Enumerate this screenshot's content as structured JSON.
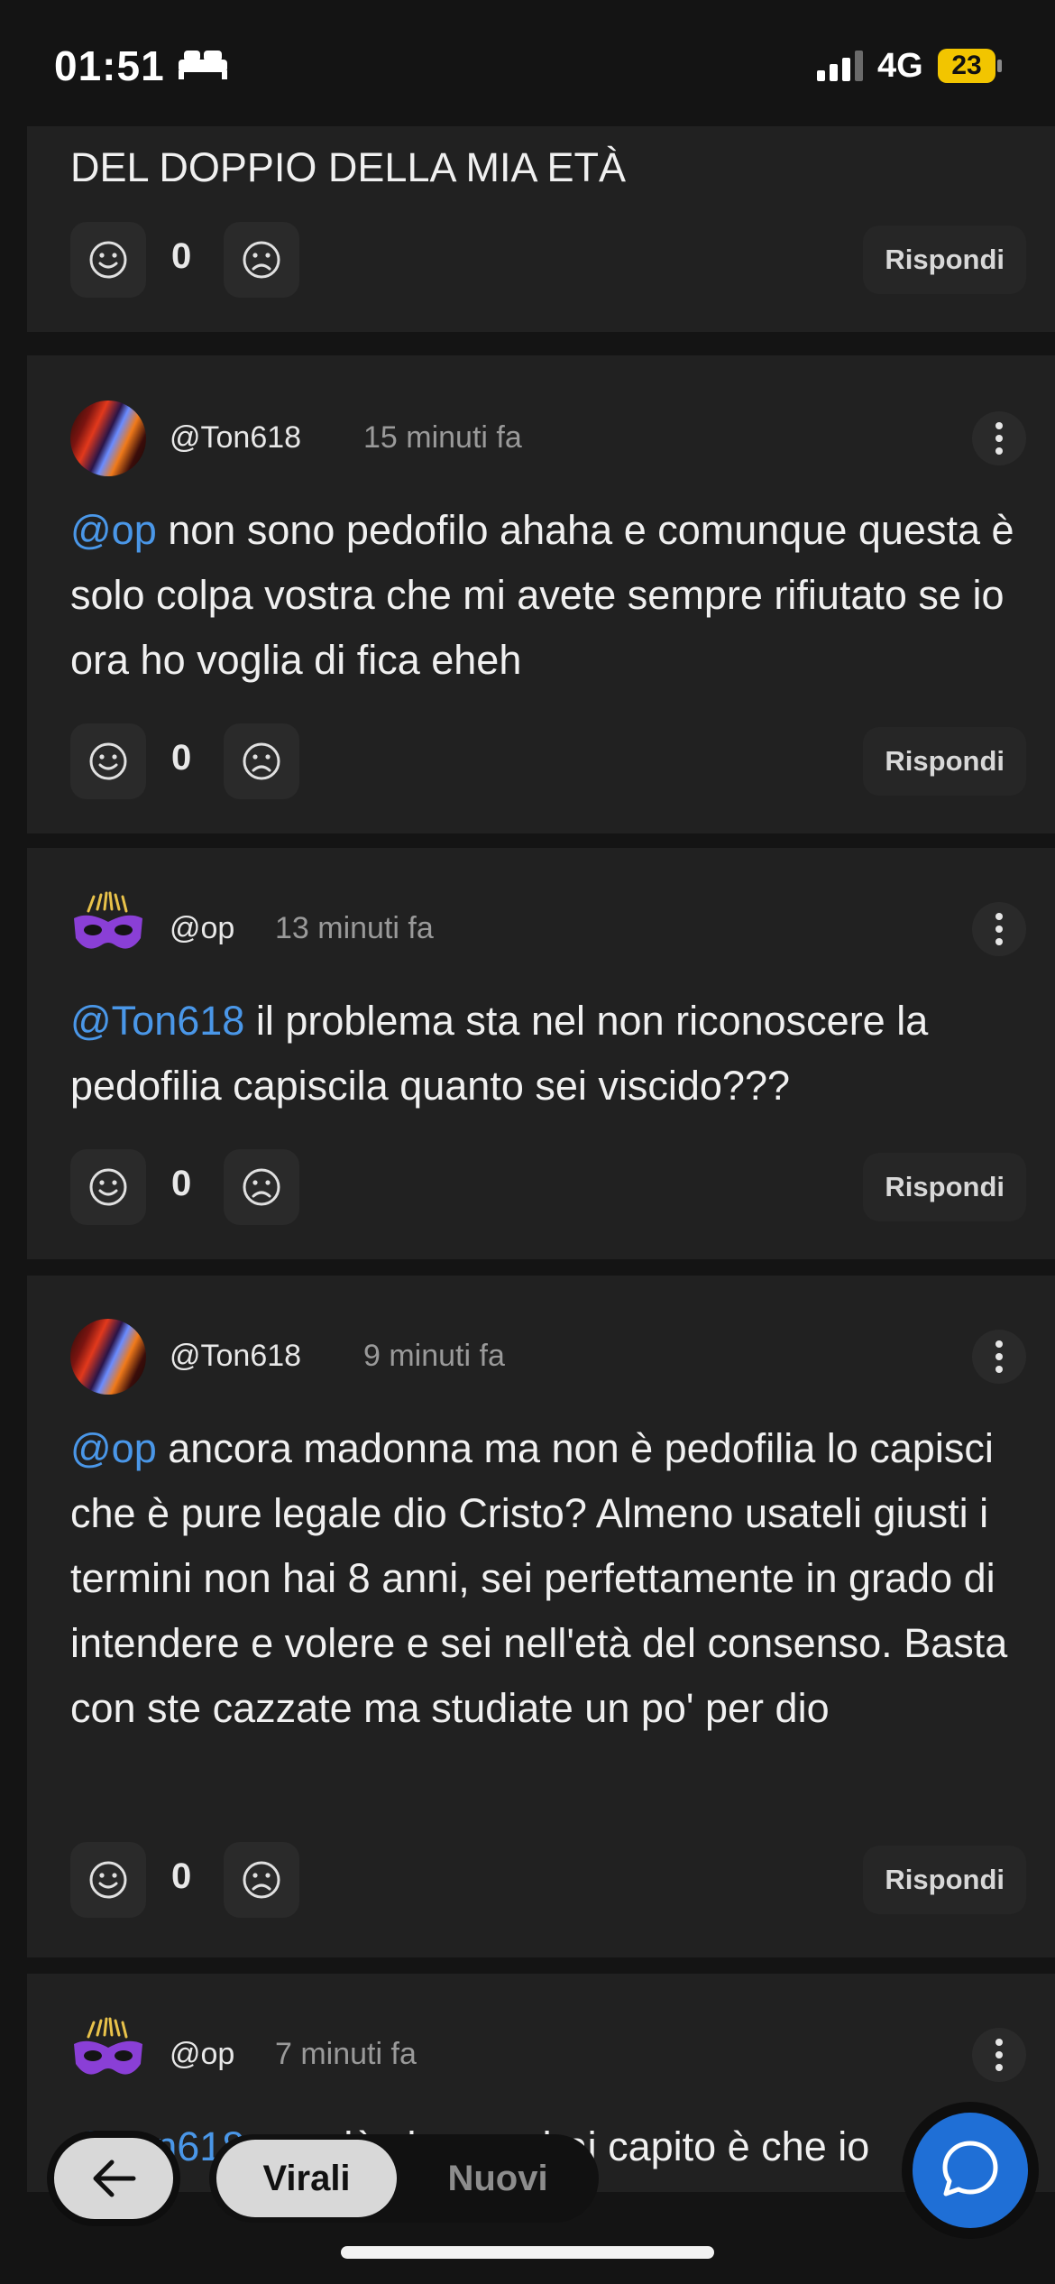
{
  "status_bar": {
    "time": "01:51",
    "sleep_icon": "bed-icon",
    "network": "4G",
    "battery": "23",
    "colors": {
      "battery": "#f2c500"
    }
  },
  "feed": {
    "top_partial_text": "DEL DOPPIO DELLA MIA ETÀ",
    "top_partial_actions": {
      "count": "0",
      "reply_label": "Rispondi"
    },
    "comments": [
      {
        "username": "@Ton618",
        "time": "15 minuti fa",
        "mention": "@op",
        "text": " non sono pedofilo ahaha e comunque questa è solo colpa vostra che mi avete sempre rifiutato se io ora ho voglia di fica eheh",
        "count": "0",
        "reply_label": "Rispondi"
      },
      {
        "username": "@op",
        "time": "13 minuti fa",
        "mention": "@Ton618",
        "text": " il problema sta nel non riconoscere la pedofilia capiscila quanto sei viscido???",
        "count": "0",
        "reply_label": "Rispondi"
      },
      {
        "username": "@Ton618",
        "time": "9 minuti fa",
        "mention": "@op",
        "text": " ancora madonna ma non è pedofilia lo capisci che è pure legale dio Cristo? Almeno usateli giusti i termini non hai 8 anni, sei perfettamente in grado di intendere e volere e sei nell'età del consenso. Basta con ste cazzate ma studiate un po' per dio",
        "count": "0",
        "reply_label": "Rispondi"
      },
      {
        "username": "@op",
        "time": "7 minuti fa",
        "mention": "@Ton618",
        "text": " ma ciò che non hai capito è che io"
      }
    ]
  },
  "bottom_nav": {
    "back_icon": "arrow-left-icon",
    "tabs": [
      "Virali",
      "Nuovi"
    ],
    "selected_tab": "Virali",
    "chat_icon": "chat-bubble-icon",
    "colors": {
      "fab": "#1f6fd6",
      "mention": "#4a97e8"
    }
  }
}
